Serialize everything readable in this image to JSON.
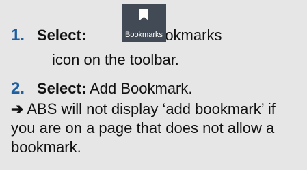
{
  "step1": {
    "number": "1.",
    "action": "Select:",
    "text_after_icon": "Bookmarks",
    "line2": "icon on the toolbar."
  },
  "toolbar_button": {
    "label": "Bookmarks",
    "icon": "bookmark-icon",
    "background": "#414a55"
  },
  "step2": {
    "number": "2.",
    "action": "Select:",
    "text": "Add Bookmark."
  },
  "note": {
    "arrow": "➔",
    "text": "ABS will not display ‘add bookmark’ if you are on a page that does not allow a bookmark."
  },
  "colors": {
    "step_number": "#1f5fa0",
    "background": "#e6e6e6"
  }
}
